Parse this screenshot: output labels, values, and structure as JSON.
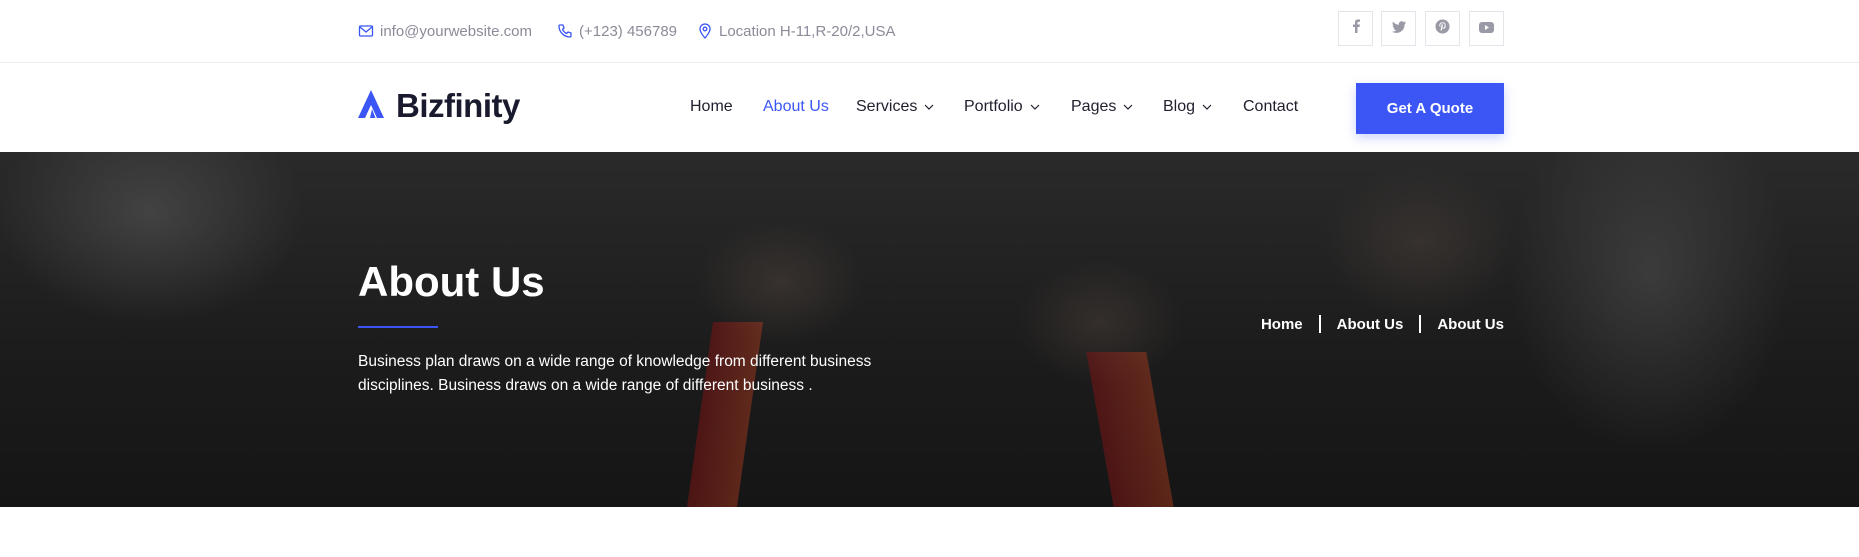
{
  "topbar": {
    "email": "info@yourwebsite.com",
    "phone": "(+123) 456789",
    "location": "Location H-11,R-20/2,USA",
    "icons": [
      "mail-icon",
      "phone-icon",
      "location-icon"
    ],
    "social": [
      "facebook-icon",
      "twitter-icon",
      "pinterest-icon",
      "youtube-icon"
    ]
  },
  "brand": {
    "name": "Bizfinity",
    "accent": "#3b56f5"
  },
  "nav": {
    "items": [
      {
        "label": "Home",
        "has_dropdown": false,
        "active": false
      },
      {
        "label": "About Us",
        "has_dropdown": false,
        "active": true
      },
      {
        "label": "Services",
        "has_dropdown": true,
        "active": false
      },
      {
        "label": "Portfolio",
        "has_dropdown": true,
        "active": false
      },
      {
        "label": "Pages",
        "has_dropdown": true,
        "active": false
      },
      {
        "label": "Blog",
        "has_dropdown": true,
        "active": false
      },
      {
        "label": "Contact",
        "has_dropdown": false,
        "active": false
      }
    ],
    "cta_label": "Get A Quote"
  },
  "hero": {
    "title": "About Us",
    "description": "Business plan draws on a wide range of knowledge from different business disciplines. Business draws on a wide range of different business .",
    "breadcrumb": [
      "Home",
      "About Us",
      "About Us"
    ]
  }
}
